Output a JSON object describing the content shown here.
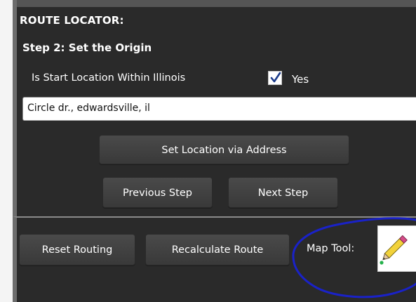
{
  "panel": {
    "title": "ROUTE LOCATOR:",
    "step_title": "Step 2:  Set the Origin",
    "within_illinois_label": "Is Start Location Within Illinois",
    "within_illinois_checked": true,
    "yes_label": "Yes",
    "address_value": "Circle dr., edwardsville, il",
    "set_location_button": "Set Location via Address",
    "previous_step_button": "Previous Step",
    "next_step_button": "Next Step"
  },
  "toolbar": {
    "reset_routing_button": "Reset Routing",
    "recalculate_route_button": "Recalculate Route",
    "map_tool_label": "Map Tool:",
    "map_tool_icon": "pencil-icon"
  },
  "colors": {
    "panel_background": "#2a2a2a",
    "button_background": "#404040",
    "annotation_blue": "#1a22c8"
  }
}
